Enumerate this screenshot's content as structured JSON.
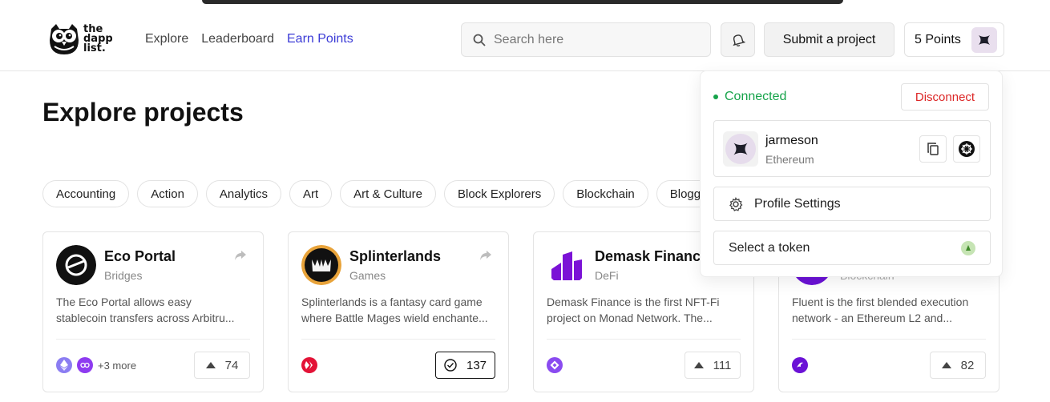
{
  "brand": {
    "logo_text_1": "the",
    "logo_text_2": "dapp",
    "logo_text_3": "list."
  },
  "nav": {
    "items": [
      {
        "label": "Explore"
      },
      {
        "label": "Leaderboard"
      },
      {
        "label": "Earn Points"
      }
    ],
    "active": "Earn Points"
  },
  "search": {
    "placeholder": "Search here"
  },
  "header": {
    "submit_label": "Submit a project",
    "points_label": "5 Points"
  },
  "page": {
    "title": "Explore projects"
  },
  "categories": [
    "Accounting",
    "Action",
    "Analytics",
    "Art",
    "Art & Culture",
    "Block Explorers",
    "Blockchain",
    "Bloggi"
  ],
  "projects": [
    {
      "name": "Eco Portal",
      "category": "Bridges",
      "description_1": "The Eco Portal allows easy",
      "description_2": "stablecoin transfers across Arbitru...",
      "more_chains": "+3 more",
      "votes": "74"
    },
    {
      "name": "Splinterlands",
      "category": "Games",
      "description_1": "Splinterlands is a fantasy card game",
      "description_2": "where Battle Mages wield enchante...",
      "more_chains": "",
      "votes": "137"
    },
    {
      "name": "Demask Finance",
      "category": "DeFi",
      "description_1": "Demask Finance is the first NFT-Fi",
      "description_2": "project on Monad Network. The...",
      "more_chains": "",
      "votes": "111"
    },
    {
      "name": "",
      "category": "Blockchain",
      "description_1": "Fluent is the first blended execution",
      "description_2": "network - an Ethereum L2 and...",
      "more_chains": "",
      "votes": "82"
    }
  ],
  "wallet": {
    "status": "Connected",
    "disconnect_label": "Disconnect",
    "username": "jarmeson",
    "network": "Ethereum",
    "profile_settings_label": "Profile Settings",
    "select_token_label": "Select a token"
  },
  "colors": {
    "accent": "#3b3bd6",
    "connected": "#16a34a",
    "disconnect": "#dc2626"
  },
  "icons": {
    "search": "search-icon",
    "bell": "bell-icon",
    "share": "share-icon",
    "upvote": "triangle-up-icon",
    "copy": "copy-icon",
    "gear": "gear-icon"
  }
}
